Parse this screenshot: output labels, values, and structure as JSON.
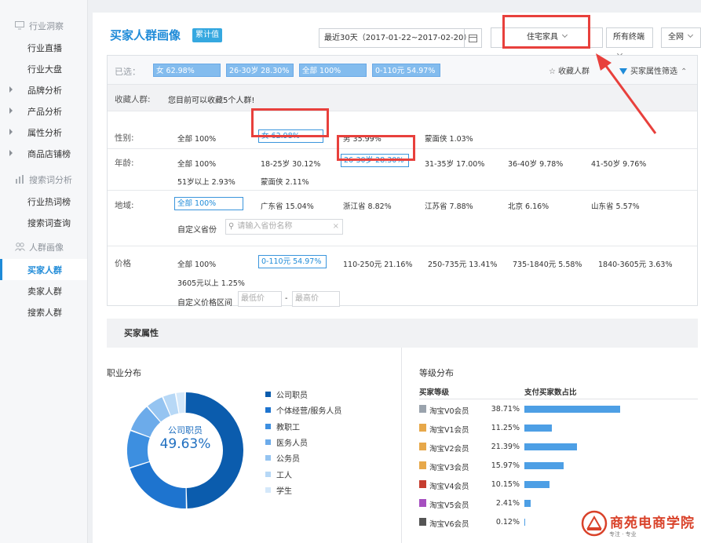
{
  "sidebar": {
    "groups": [
      {
        "label": "行业洞察",
        "icon": "monitor-icon"
      },
      {
        "label": "搜索词分析",
        "icon": "chart-bars-icon"
      },
      {
        "label": "人群画像",
        "icon": "people-icon"
      }
    ],
    "items": {
      "industry_live": "行业直播",
      "industry_overview": "行业大盘",
      "brand_analysis": "品牌分析",
      "product_analysis": "产品分析",
      "attribute_analysis": "属性分析",
      "shop_ranking": "商品店铺榜",
      "hot_words": "行业热词榜",
      "word_query": "搜索词查询",
      "buyer_crowd": "买家人群",
      "seller_crowd": "卖家人群",
      "searcher_crowd": "搜索人群"
    }
  },
  "header": {
    "title": "买家人群画像",
    "badge": "累计值",
    "date_range": "最近30天（2017-01-22~2017-02-20）",
    "category": "住宅家具",
    "terminal": "所有终端",
    "network": "全网"
  },
  "chosen": {
    "label": "已选：",
    "chips": [
      "女 62.98%",
      "26-30岁 28.30%",
      "全部 100%",
      "0-110元 54.97%"
    ],
    "fav_label": "收藏人群",
    "filter_label": "买家属性筛选"
  },
  "favorites": {
    "label": "收藏人群:",
    "note": "您目前可以收藏5个人群!"
  },
  "gender": {
    "label": "性别:",
    "options": [
      "全部  100%",
      "女  62.98%",
      "男  35.99%",
      "蒙面侠  1.03%"
    ]
  },
  "age": {
    "label": "年龄:",
    "options": [
      "全部  100%",
      "18-25岁  30.12%",
      "26-30岁  28.30%",
      "31-35岁  17.00%",
      "36-40岁  9.78%",
      "41-50岁  9.76%",
      "51岁以上  2.93%",
      "蒙面侠  2.11%"
    ]
  },
  "region": {
    "label": "地域:",
    "options": [
      "全部  100%",
      "广东省  15.04%",
      "浙江省  8.82%",
      "江苏省  7.88%",
      "北京  6.16%",
      "山东省  5.57%"
    ],
    "custom_label": "自定义省份",
    "search_placeholder": "请输入省份名称"
  },
  "price": {
    "label": "价格",
    "options": [
      "全部  100%",
      "0-110元  54.97%",
      "110-250元  21.16%",
      "250-735元  13.41%",
      "735-1840元  5.58%",
      "1840-3605元  3.63%",
      "3605元以上  1.25%"
    ],
    "custom_label": "自定义价格区间",
    "min_placeholder": "最低价",
    "max_placeholder": "最高价",
    "separator": "-"
  },
  "attributes": {
    "section_title": "买家属性",
    "occupation_title": "职业分布",
    "donut_center_label": "公司职员",
    "donut_center_value": "49.63%",
    "level_title": "等级分布",
    "level_col1": "买家等级",
    "level_col2": "支付买家数占比"
  },
  "colors": {
    "accent": "#1f8bd8",
    "highlight_red": "#e8403c",
    "chip_blue": "#83bcee",
    "bar_blue": "#4d9fe5"
  },
  "chart_data": [
    {
      "type": "pie",
      "title": "职业分布",
      "categories": [
        "公司职员",
        "个体经营/服务人员",
        "教职工",
        "医务人员",
        "公务员",
        "工人",
        "学生"
      ],
      "values": [
        49.63,
        20.5,
        10.5,
        8.0,
        5.0,
        3.7,
        2.67
      ],
      "colors": [
        "#0b5cad",
        "#1e74cf",
        "#3d8fe0",
        "#6cabea",
        "#95c4f1",
        "#b7d8f6",
        "#d4e8fa"
      ],
      "legend": "right"
    },
    {
      "type": "bar",
      "title": "等级分布",
      "categories": [
        "淘宝V0会员",
        "淘宝V1会员",
        "淘宝V2会员",
        "淘宝V3会员",
        "淘宝V4会员",
        "淘宝V5会员",
        "淘宝V6会员"
      ],
      "values": [
        38.71,
        11.25,
        21.39,
        15.97,
        10.15,
        2.41,
        0.12
      ],
      "labels": [
        "38.71%",
        "11.25%",
        "21.39%",
        "15.97%",
        "10.15%",
        "2.41%",
        "0.12%"
      ],
      "icon_colors": [
        "#9aa3ad",
        "#e7a84a",
        "#e7a84a",
        "#e7a84a",
        "#c63d2f",
        "#a64fc0",
        "#555"
      ]
    }
  ],
  "watermark": {
    "name": "商苑电商学院",
    "tagline": "专注 · 专业"
  }
}
